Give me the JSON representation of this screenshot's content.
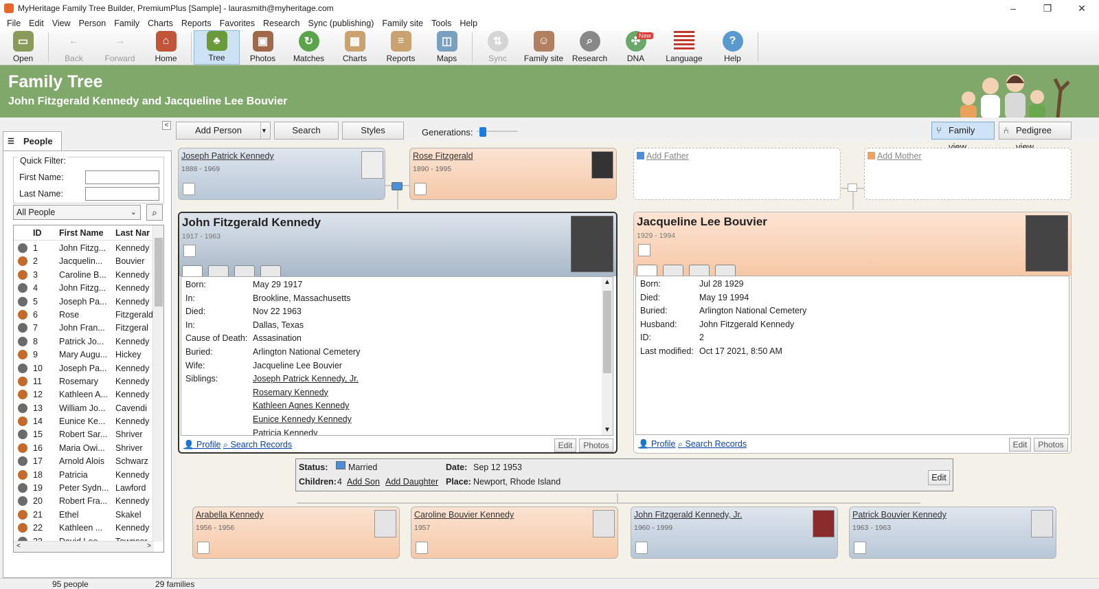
{
  "window": {
    "title": "MyHeritage Family Tree Builder, PremiumPlus [Sample] - laurasmith@myheritage.com",
    "controls": [
      "–",
      "❐",
      "✕"
    ]
  },
  "menu": [
    "File",
    "Edit",
    "View",
    "Person",
    "Family",
    "Charts",
    "Reports",
    "Favorites",
    "Research",
    "Sync (publishing)",
    "Family site",
    "Tools",
    "Help"
  ],
  "toolbar": {
    "buttons": [
      {
        "label": "Open",
        "icon": "folder-icon",
        "color": "#8a9a5b"
      },
      {
        "label": "Back",
        "icon": "back-arrow-icon",
        "color": "#cfcfcf"
      },
      {
        "label": "Forward",
        "icon": "forward-arrow-icon",
        "color": "#cfcfcf"
      },
      {
        "label": "Home",
        "icon": "home-icon",
        "color": "#c0553a"
      },
      {
        "label": "Tree",
        "icon": "tree-icon",
        "color": "#6a9a3a"
      },
      {
        "label": "Photos",
        "icon": "photos-icon",
        "color": "#a06a4a"
      },
      {
        "label": "Matches",
        "icon": "matches-icon",
        "color": "#5aa54a"
      },
      {
        "label": "Charts",
        "icon": "charts-icon",
        "color": "#c9a270"
      },
      {
        "label": "Reports",
        "icon": "reports-icon",
        "color": "#c9a270"
      },
      {
        "label": "Maps",
        "icon": "maps-icon",
        "color": "#7aa0c0"
      },
      {
        "label": "Sync",
        "icon": "sync-icon",
        "color": "#cfcfcf"
      },
      {
        "label": "Family site",
        "icon": "family-site-icon",
        "color": "#b08060"
      },
      {
        "label": "Research",
        "icon": "research-icon",
        "color": "#888888"
      },
      {
        "label": "DNA",
        "icon": "dna-icon",
        "color": "#6aa86a",
        "badge": "New"
      },
      {
        "label": "Language",
        "icon": "us-flag-icon",
        "color": "#c0392b"
      },
      {
        "label": "Help",
        "icon": "help-icon",
        "color": "#5a9ad0"
      }
    ]
  },
  "banner": {
    "title": "Family Tree",
    "subtitle": "John Fitzgerald Kennedy and Jacqueline Lee Bouvier",
    "color": "#7fa86a"
  },
  "leftpanel": {
    "tab_label": "People",
    "quick_filter": "Quick Filter:",
    "first_name_label": "First Name:",
    "last_name_label": "Last Name:",
    "first_name_value": "",
    "last_name_value": "",
    "filter_selected": "All People",
    "columns": [
      "ID",
      "First Name",
      "Last Nar"
    ],
    "rows": [
      {
        "id": "1",
        "first": "John Fitzg...",
        "last": "Kennedy",
        "g": "m"
      },
      {
        "id": "2",
        "first": "Jacquelin...",
        "last": "Bouvier",
        "g": "f"
      },
      {
        "id": "3",
        "first": "Caroline B...",
        "last": "Kennedy",
        "g": "f"
      },
      {
        "id": "4",
        "first": "John Fitzg...",
        "last": "Kennedy",
        "g": "m"
      },
      {
        "id": "5",
        "first": "Joseph Pa...",
        "last": "Kennedy",
        "g": "m"
      },
      {
        "id": "6",
        "first": "Rose",
        "last": "Fitzgerald",
        "g": "f"
      },
      {
        "id": "7",
        "first": "John Fran...",
        "last": "Fitzgeral",
        "g": "m"
      },
      {
        "id": "8",
        "first": "Patrick Jo...",
        "last": "Kennedy",
        "g": "m"
      },
      {
        "id": "9",
        "first": "Mary Augu...",
        "last": "Hickey",
        "g": "f"
      },
      {
        "id": "10",
        "first": "Joseph Pa...",
        "last": "Kennedy",
        "g": "m"
      },
      {
        "id": "11",
        "first": "Rosemary",
        "last": "Kennedy",
        "g": "f"
      },
      {
        "id": "12",
        "first": "Kathleen A...",
        "last": "Kennedy",
        "g": "f"
      },
      {
        "id": "13",
        "first": "William Jo...",
        "last": "Cavendi",
        "g": "m"
      },
      {
        "id": "14",
        "first": "Eunice Ke...",
        "last": "Kennedy",
        "g": "f"
      },
      {
        "id": "15",
        "first": "Robert Sar...",
        "last": "Shriver",
        "g": "m"
      },
      {
        "id": "16",
        "first": "Maria Owi...",
        "last": "Shriver",
        "g": "f"
      },
      {
        "id": "17",
        "first": "Arnold Alois",
        "last": "Schwarz",
        "g": "m"
      },
      {
        "id": "18",
        "first": "Patricia",
        "last": "Kennedy",
        "g": "f"
      },
      {
        "id": "19",
        "first": "Peter Sydn...",
        "last": "Lawford",
        "g": "m"
      },
      {
        "id": "20",
        "first": "Robert Fra...",
        "last": "Kennedy",
        "g": "m"
      },
      {
        "id": "21",
        "first": "Ethel",
        "last": "Skakel",
        "g": "f"
      },
      {
        "id": "22",
        "first": "Kathleen ...",
        "last": "Kennedy",
        "g": "f"
      },
      {
        "id": "23",
        "first": "David Lee",
        "last": "Townser",
        "g": "m"
      }
    ]
  },
  "statusbar": {
    "people": "95 people",
    "families": "29 families"
  },
  "main": {
    "add_person": "Add Person",
    "search": "Search",
    "styles": "Styles",
    "generations": "Generations:",
    "family_view": "Family view",
    "pedigree_view": "Pedigree view"
  },
  "parents": {
    "father_h": {
      "name": "Joseph Patrick Kennedy",
      "years": "1888 - 1969"
    },
    "mother_h": {
      "name": "Rose Fitzgerald",
      "years": "1890 - 1995"
    },
    "add_father": "Add Father",
    "add_mother": "Add Mother"
  },
  "husband": {
    "name": "John Fitzgerald Kennedy",
    "years": "1917 - 1963",
    "details": [
      {
        "k": "Born:",
        "v": "May 29 1917"
      },
      {
        "k": "In:",
        "v": "Brookline, Massachusetts"
      },
      {
        "k": "Died:",
        "v": "Nov 22 1963"
      },
      {
        "k": "In:",
        "v": "Dallas, Texas"
      },
      {
        "k": "Cause of Death:",
        "v": "Assasination"
      },
      {
        "k": "Buried:",
        "v": "Arlington National Cemetery"
      },
      {
        "k": "Wife:",
        "v": "Jacqueline Lee Bouvier"
      },
      {
        "k": "Siblings:",
        "v": "Joseph Patrick Kennedy, Jr."
      }
    ],
    "siblings_more": [
      "Rosemary Kennedy",
      "Kathleen Agnes Kennedy",
      "Eunice Kennedy Kennedy",
      "Patricia Kennedy"
    ],
    "profile": "Profile",
    "search_records": "Search Records",
    "edit": "Edit",
    "photos": "Photos"
  },
  "wife": {
    "name": "Jacqueline Lee Bouvier",
    "years": "1929 - 1994",
    "details": [
      {
        "k": "Born:",
        "v": "Jul 28 1929"
      },
      {
        "k": "Died:",
        "v": "May 19 1994"
      },
      {
        "k": "Buried:",
        "v": "Arlington National Cemetery"
      },
      {
        "k": "Husband:",
        "v": "John Fitzgerald Kennedy"
      },
      {
        "k": "ID:",
        "v": "2"
      },
      {
        "k": "Last modified:",
        "v": "Oct 17 2021, 8:50 AM"
      }
    ],
    "profile": "Profile",
    "search_records": "Search Records",
    "edit": "Edit",
    "photos": "Photos"
  },
  "marriage": {
    "status_label": "Status:",
    "status": "Married",
    "children_label": "Children:",
    "children_count": "4",
    "add_son": "Add Son",
    "add_daughter": "Add Daughter",
    "date_label": "Date:",
    "date": "Sep 12 1953",
    "place_label": "Place:",
    "place": "Newport, Rhode Island",
    "edit": "Edit"
  },
  "children": [
    {
      "name": "Arabella Kennedy",
      "years": "1956 - 1956",
      "g": "f"
    },
    {
      "name": "Caroline Bouvier Kennedy",
      "years": "1957",
      "g": "f"
    },
    {
      "name": "John Fitzgerald Kennedy, Jr.",
      "years": "1960 - 1999",
      "g": "m"
    },
    {
      "name": "Patrick Bouvier Kennedy",
      "years": "1963 - 1963",
      "g": "m"
    }
  ]
}
